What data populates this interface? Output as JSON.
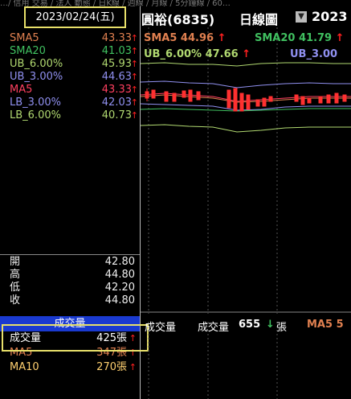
{
  "top_tabs": "…/ 信用 交易 / 法人 動態 / 日K線 / 週線 / 月線 / 5分鐘線 / 60…",
  "date_label": "2023/02/24(五)",
  "stock": {
    "name": "圓裕(6835)",
    "chart_mode": "日線圖",
    "year_text": "2023"
  },
  "indicators": [
    {
      "label": "SMA5",
      "value": "43.33",
      "arrow": "↑",
      "color": "#e08050"
    },
    {
      "label": "SMA20",
      "value": "41.03",
      "arrow": "↑",
      "color": "#40c060"
    },
    {
      "label": "UB_6.00%",
      "value": "45.93",
      "arrow": "↑",
      "color": "#b0d870"
    },
    {
      "label": "UB_3.00%",
      "value": "44.63",
      "arrow": "↑",
      "color": "#9090f0"
    },
    {
      "label": "MA5",
      "value": "43.33",
      "arrow": "↑",
      "color": "#ff4060"
    },
    {
      "label": "LB_3.00%",
      "value": "42.03",
      "arrow": "↑",
      "color": "#9090f0"
    },
    {
      "label": "LB_6.00%",
      "value": "40.73",
      "arrow": "↑",
      "color": "#b0d870"
    }
  ],
  "ohlc": [
    {
      "label": "開",
      "value": "42.80"
    },
    {
      "label": "高",
      "value": "44.80"
    },
    {
      "label": "低",
      "value": "42.20"
    },
    {
      "label": "收",
      "value": "44.80"
    }
  ],
  "volume": {
    "header": "成交量",
    "rows": [
      {
        "label": "成交量",
        "value": "425張",
        "arrow": "↑",
        "color": "#ffffff"
      },
      {
        "label": "MA5",
        "value": "347張",
        "arrow": "↑",
        "color": "#e08050"
      },
      {
        "label": "MA10",
        "value": "270張",
        "arrow": "↑",
        "color": "#ffd070"
      }
    ]
  },
  "chart_legend": {
    "sma5_label": "SMA5 44.96",
    "sma20_label": "SMA20 41.79",
    "ub6_label": "UB_6.00% 47.66",
    "ub3_label": "UB_3.00",
    "arrow_up": "↑"
  },
  "volume_legend": {
    "title": "成交量",
    "vol_label": "成交量",
    "vol_value": "655",
    "arrow_down": "↓",
    "unit": "張",
    "ma5_label": "MA5 5"
  },
  "colors": {
    "sma5": "#e08050",
    "sma20": "#40c060",
    "ub6": "#b0d870",
    "ub3": "#9090f0",
    "ma5": "#ff4060",
    "highlight": "#e8e06a",
    "volume_header_bg": "#1a3ad0"
  }
}
